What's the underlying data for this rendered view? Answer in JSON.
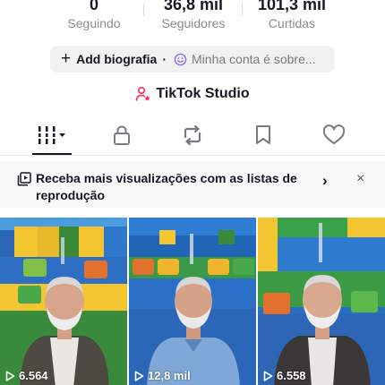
{
  "stats": [
    {
      "value": "0",
      "label": "Seguindo"
    },
    {
      "value": "36,8 mil",
      "label": "Seguidores"
    },
    {
      "value": "101,3 mil",
      "label": "Curtidas"
    }
  ],
  "bio": {
    "add_label": "Add biografia",
    "separator": "·",
    "hint": "Minha conta é sobre..."
  },
  "studio": {
    "label": "TikTok Studio"
  },
  "tabs": [
    {
      "icon": "grid-bars-icon",
      "active": true
    },
    {
      "icon": "lock-icon",
      "active": false
    },
    {
      "icon": "repost-icon",
      "active": false
    },
    {
      "icon": "bookmark-icon",
      "active": false
    },
    {
      "icon": "heart-icon",
      "active": false
    }
  ],
  "banner": {
    "text": "Receba mais visualizações com as listas de reprodução",
    "chevron": "›",
    "close": "×"
  },
  "videos": [
    {
      "views": "6.564"
    },
    {
      "views": "12,8 mil"
    },
    {
      "views": "6.558"
    }
  ],
  "colors": {
    "text": "#161823",
    "muted": "#8a8b91",
    "pill": "#f1f1f2",
    "accent_pink": "#fe2c55",
    "smile_purple": "#8f6ee8"
  }
}
